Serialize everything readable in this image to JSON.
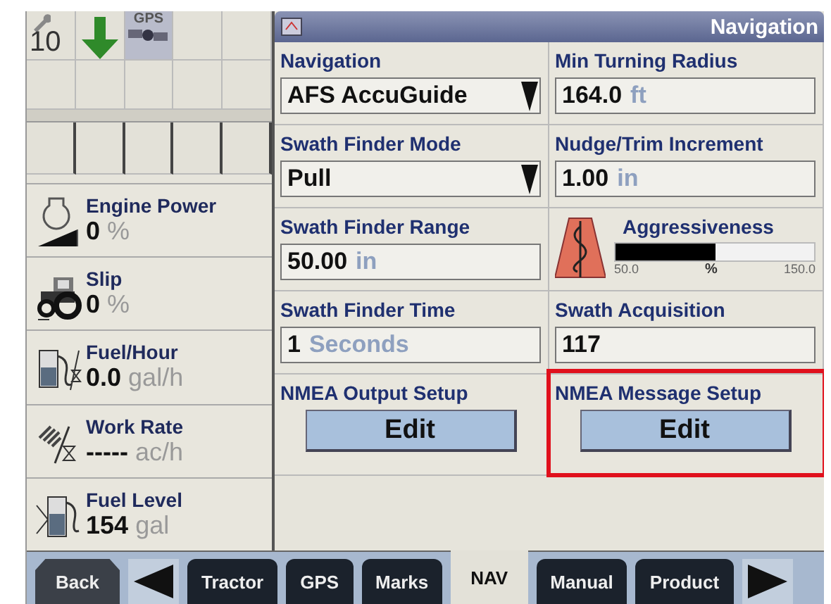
{
  "status_icons": {
    "wrench_count": "10",
    "gps_label": "GPS"
  },
  "readouts": [
    {
      "kind": "engine",
      "label": "Engine Power",
      "value": "0",
      "unit": "%"
    },
    {
      "kind": "slip",
      "label": "Slip",
      "value": "0",
      "unit": "%"
    },
    {
      "kind": "fuel-rate",
      "label": "Fuel/Hour",
      "value": "0.0",
      "unit": "gal/h"
    },
    {
      "kind": "work-rate",
      "label": "Work Rate",
      "value": "-----",
      "unit": "ac/h"
    },
    {
      "kind": "fuel-level",
      "label": "Fuel Level",
      "value": "154",
      "unit": "gal"
    }
  ],
  "panel": {
    "title": "Navigation"
  },
  "settings": [
    {
      "kind": "dropdown",
      "label": "Navigation",
      "value": "AFS AccuGuide"
    },
    {
      "kind": "field",
      "label": "Min Turning Radius",
      "value": "164.0",
      "unit": "ft"
    },
    {
      "kind": "dropdown",
      "label": "Swath Finder Mode",
      "value": "Pull"
    },
    {
      "kind": "field",
      "label": "Nudge/Trim Increment",
      "value": "1.00",
      "unit": "in"
    },
    {
      "kind": "field",
      "label": "Swath Finder Range",
      "value": "50.00",
      "unit": "in"
    },
    {
      "kind": "meter",
      "label": "Aggressiveness",
      "level": 0.5,
      "min": "50.0",
      "unit": "%",
      "max": "150.0"
    },
    {
      "kind": "field",
      "label": "Swath Finder Time",
      "value": "1",
      "unit": "Seconds"
    },
    {
      "kind": "field",
      "label": "Swath Acquisition",
      "value": "117"
    },
    {
      "kind": "button",
      "label": "NMEA Output Setup",
      "button": "Edit",
      "highlighted": false
    },
    {
      "kind": "button",
      "label": "NMEA Message Setup",
      "button": "Edit",
      "highlighted": true
    }
  ],
  "nav_bar": [
    {
      "kind": "back",
      "label": "Back"
    },
    {
      "kind": "arrow-left"
    },
    {
      "kind": "tab",
      "label": "Tractor",
      "selected": false
    },
    {
      "kind": "tab",
      "label": "GPS",
      "selected": false
    },
    {
      "kind": "tab",
      "label": "Marks",
      "selected": false
    },
    {
      "kind": "tab",
      "label": "NAV",
      "selected": true
    },
    {
      "kind": "tab",
      "label": "Manual",
      "selected": false
    },
    {
      "kind": "tab",
      "label": "Product",
      "selected": false
    },
    {
      "kind": "arrow-right"
    }
  ]
}
